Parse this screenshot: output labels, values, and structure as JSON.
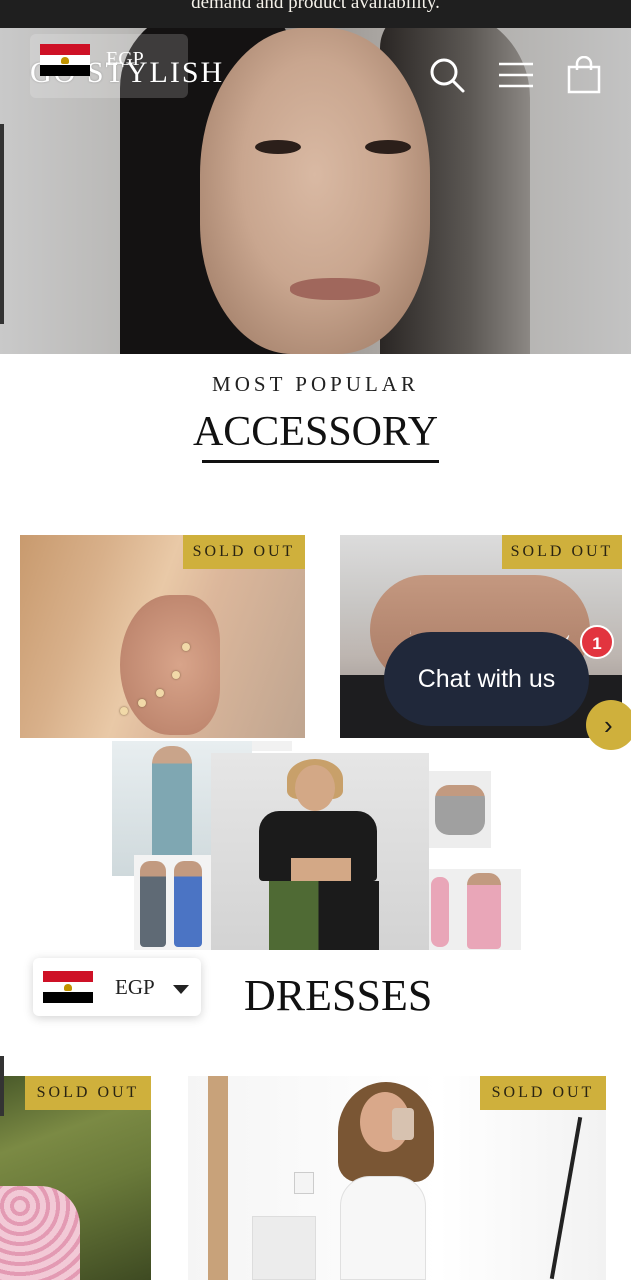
{
  "announcement": {
    "text": "demand and product availability."
  },
  "header": {
    "logo": "GO STYLISH",
    "currency": {
      "code": "EGP",
      "flag_icon": "egypt-flag-icon"
    },
    "icons": [
      "search-icon",
      "menu-icon",
      "shopping-bag-icon"
    ]
  },
  "section_accessory": {
    "eyebrow": "MOST POPULAR",
    "title": "ACCESSORY",
    "products": [
      {
        "badge": "SOLD OUT",
        "image": "ear cuff earring"
      },
      {
        "badge": "SOLD OUT",
        "image": "butterfly anklet"
      }
    ]
  },
  "chat": {
    "label": "Chat with us",
    "unread_count": "1"
  },
  "carousel": {
    "next_icon": "chevron-right-icon"
  },
  "currency_selector": {
    "code": "EGP",
    "flag_icon": "egypt-flag-icon",
    "caret_icon": "caret-down-icon"
  },
  "section_dresses": {
    "title": "DRESSES",
    "products": [
      {
        "badge": "SOLD OUT"
      },
      {
        "badge": "SOLD OUT"
      }
    ]
  },
  "colors": {
    "badge": "#cfb03c",
    "chat": "#20283a",
    "notify": "#e2343f"
  }
}
